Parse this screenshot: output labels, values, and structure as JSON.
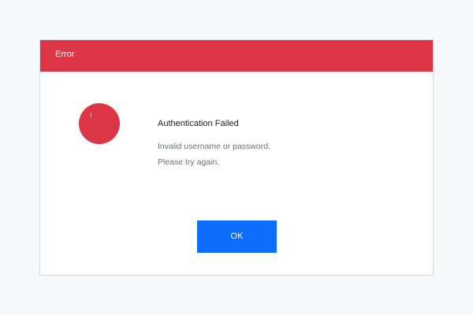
{
  "dialog": {
    "title": "Error",
    "icon": {
      "name": "exclamation-icon",
      "glyph": "!",
      "color": "#dc3545"
    },
    "heading": "Authentication Failed",
    "message_lines": [
      "Invalid username or password.",
      "Please try again."
    ],
    "ok_label": "OK"
  },
  "colors": {
    "titlebar": "#dc3545",
    "button": "#0d6efd",
    "background": "#f7f8fa"
  }
}
